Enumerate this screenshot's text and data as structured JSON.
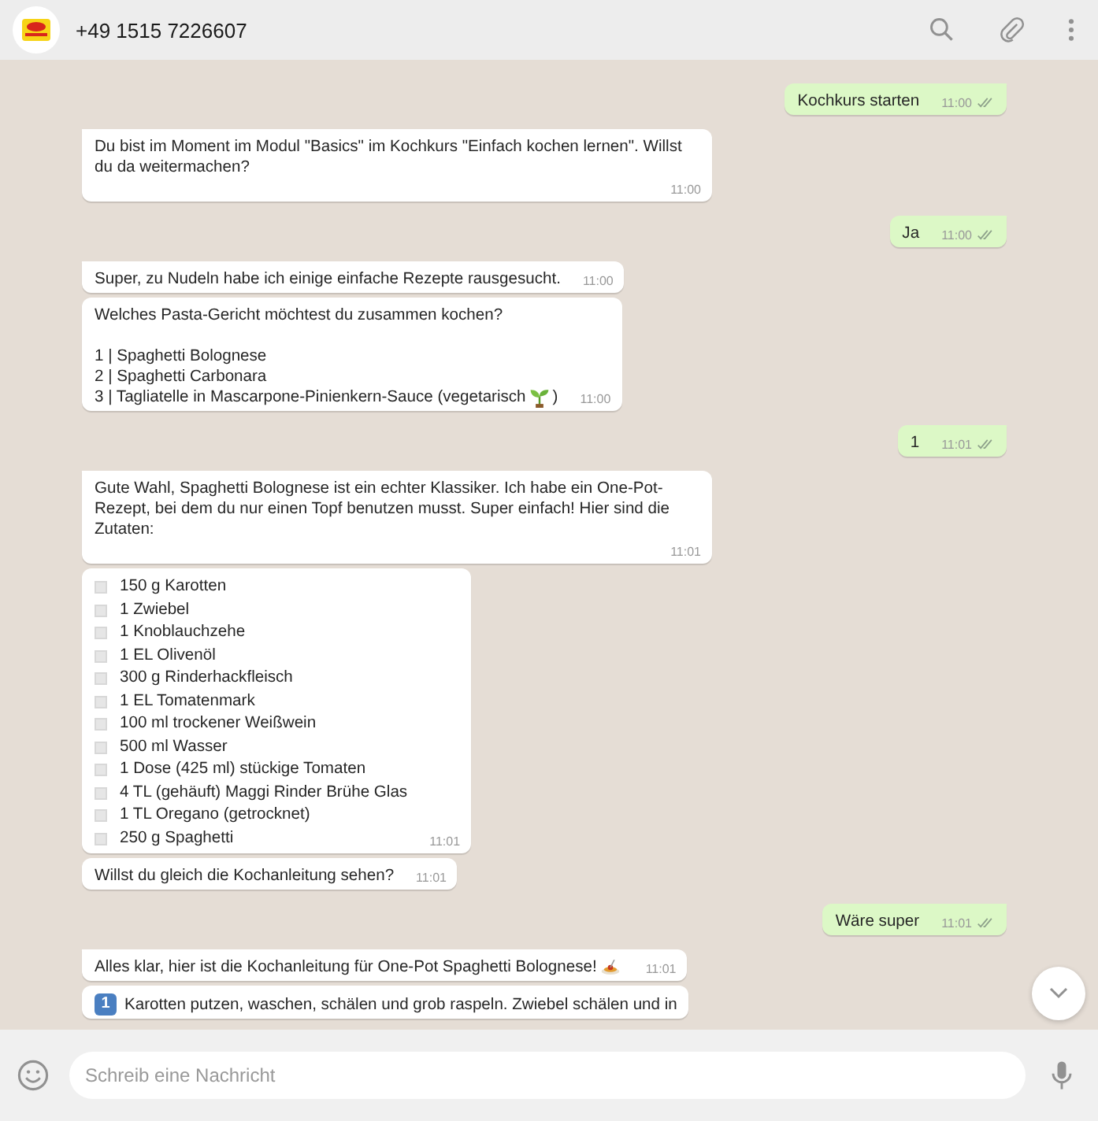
{
  "header": {
    "title": "+49 1515 7226607"
  },
  "messages": [
    {
      "sent": true,
      "group_start": true,
      "kind": "text",
      "text": "Kochkurs starten",
      "time": "11:00"
    },
    {
      "sent": false,
      "group_start": true,
      "kind": "text",
      "text": "Du bist im Moment im Modul \"Basics\" im Kochkurs \"Einfach kochen lernen\". Willst du da weitermachen?",
      "time": "11:00"
    },
    {
      "sent": true,
      "group_start": true,
      "kind": "text",
      "text": "Ja",
      "time": "11:00"
    },
    {
      "sent": false,
      "group_start": true,
      "kind": "text",
      "text": "Super, zu Nudeln habe ich einige einfache Rezepte rausgesucht.",
      "time": "11:00"
    },
    {
      "sent": false,
      "group_start": false,
      "kind": "options",
      "question": "Welches Pasta-Gericht möchtest du zusammen kochen?",
      "lines": [
        "1 | Spaghetti Bolognese",
        "2 | Spaghetti Carbonara",
        "3 | Tagliatelle in Mascarpone-Pinienkern-Sauce (vegetarisch"
      ],
      "suffix": ")",
      "time": "11:00"
    },
    {
      "sent": true,
      "group_start": true,
      "kind": "text",
      "text": "1",
      "time": "11:01"
    },
    {
      "sent": false,
      "group_start": true,
      "kind": "text",
      "text": "Gute Wahl, Spaghetti Bolognese ist ein echter Klassiker. Ich habe ein One-Pot-Rezept, bei dem du nur einen Topf benutzen musst. Super einfach! Hier sind die Zutaten:",
      "time": "11:01"
    },
    {
      "sent": false,
      "group_start": false,
      "kind": "checklist",
      "items": [
        "150 g Karotten",
        "1 Zwiebel",
        "1 Knoblauchzehe",
        "1 EL Olivenöl",
        "300 g Rinderhackfleisch",
        "1 EL Tomatenmark",
        "100 ml trockener Weißwein",
        "500 ml Wasser",
        "1 Dose (425 ml) stückige Tomaten",
        "4 TL (gehäuft) Maggi Rinder Brühe Glas",
        "1 TL Oregano (getrocknet)",
        "250 g Spaghetti"
      ],
      "time": "11:01"
    },
    {
      "sent": false,
      "group_start": false,
      "kind": "text",
      "text": "Willst du gleich die Kochanleitung sehen?",
      "time": "11:01"
    },
    {
      "sent": true,
      "group_start": true,
      "kind": "text",
      "text": "Wäre super",
      "time": "11:01"
    },
    {
      "sent": false,
      "group_start": true,
      "kind": "intro",
      "text": "Alles klar, hier ist die Kochanleitung für One-Pot Spaghetti Bolognese!",
      "time": "11:01"
    },
    {
      "sent": false,
      "group_start": false,
      "kind": "step",
      "number": "1",
      "text": "Karotten putzen, waschen, schälen und grob raspeln. Zwiebel schälen und in"
    }
  ],
  "composer": {
    "placeholder": "Schreib eine Nachricht"
  }
}
